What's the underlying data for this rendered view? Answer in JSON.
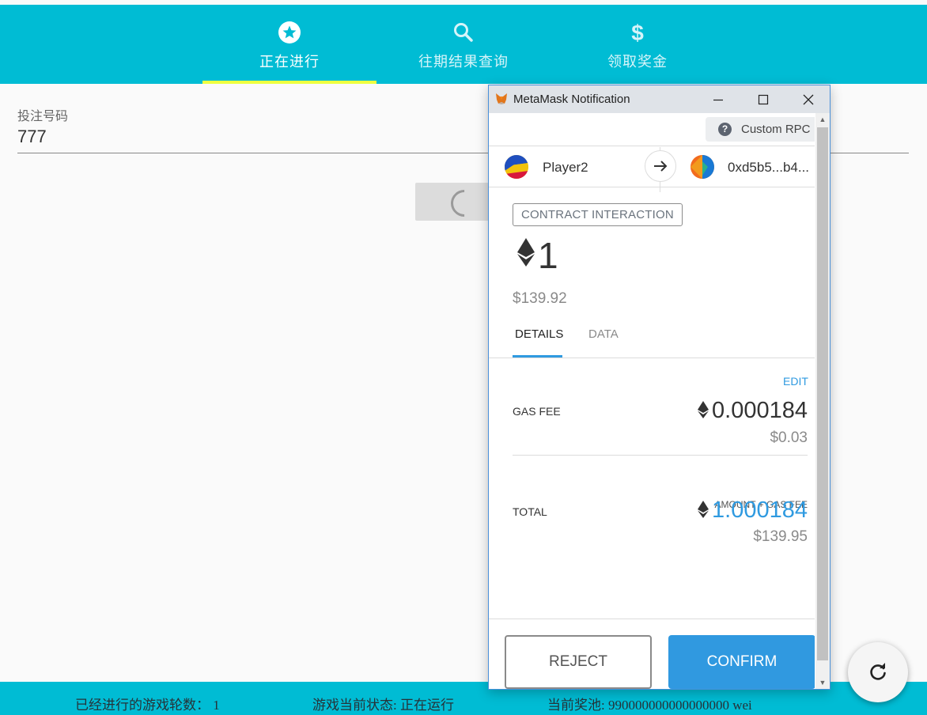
{
  "nav": {
    "tabs": [
      {
        "label": "正在进行",
        "icon": "star-circle-icon",
        "active": true
      },
      {
        "label": "往期结果查询",
        "icon": "search-icon",
        "active": false
      },
      {
        "label": "领取奖金",
        "icon": "dollar-icon",
        "active": false
      }
    ]
  },
  "form": {
    "label": "投注号码",
    "value": "777"
  },
  "footer": {
    "rounds": "已经进行的游戏轮数： 1",
    "status": "游戏当前状态: 正在运行",
    "pool": "当前奖池: 990000000000000000 wei"
  },
  "metamask": {
    "window_title": "MetaMask Notification",
    "network": "Custom RPC",
    "from_account": "Player2",
    "to_account": "0xd5b5...b4...",
    "tag": "CONTRACT INTERACTION",
    "amount": "1",
    "amount_usd": "$139.92",
    "tabs": {
      "details": "DETAILS",
      "data": "DATA"
    },
    "edit_label": "EDIT",
    "gas_fee_label": "GAS FEE",
    "gas_fee_value": "0.000184",
    "gas_fee_usd": "$0.03",
    "total_hint": "AMOUNT + GAS FEE",
    "total_label": "TOTAL",
    "total_value": "1.000184",
    "total_usd": "$139.95",
    "reject_label": "REJECT",
    "confirm_label": "CONFIRM"
  },
  "colors": {
    "primary": "#00bcd4",
    "accent_bar": "#eeff41",
    "metamask_blue": "#3099e0"
  }
}
